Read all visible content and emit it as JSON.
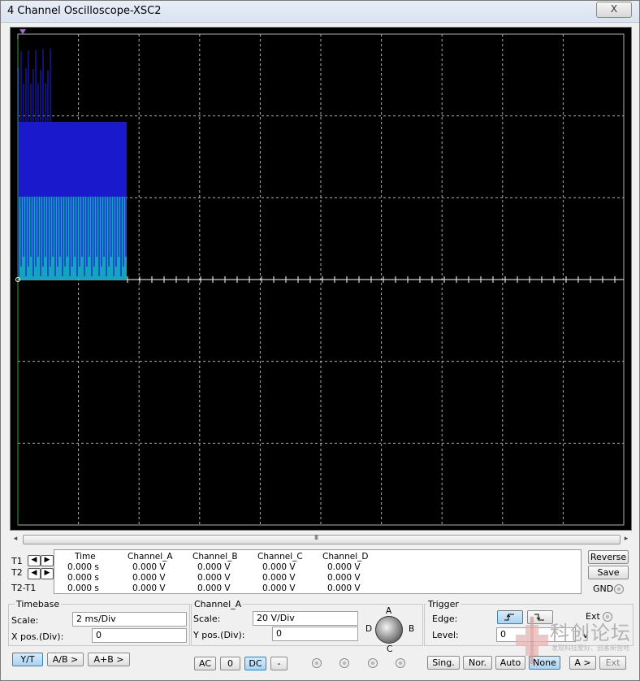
{
  "window": {
    "title": "4 Channel Oscilloscope-XSC2",
    "close_glyph": "X"
  },
  "scope": {
    "background": "#000000",
    "grid_color": "#b0b0b0",
    "channel_colors": {
      "A": "#1a1acc",
      "B": "#cc2020",
      "C": "#14a4c0",
      "D": "#30a030"
    }
  },
  "scrollbar": {
    "left_glyph": "◂",
    "right_glyph": "▸",
    "grip_glyph": "III"
  },
  "readout": {
    "headers": [
      "Time",
      "Channel_A",
      "Channel_B",
      "Channel_C",
      "Channel_D"
    ],
    "rows": [
      {
        "label": "T1",
        "time": "0.000 s",
        "a": "0.000 V",
        "b": "0.000 V",
        "c": "0.000 V",
        "d": "0.000 V"
      },
      {
        "label": "T2",
        "time": "0.000 s",
        "a": "0.000 V",
        "b": "0.000 V",
        "c": "0.000 V",
        "d": "0.000 V"
      },
      {
        "label": "T2-T1",
        "time": "0.000 s",
        "a": "0.000 V",
        "b": "0.000 V",
        "c": "0.000 V",
        "d": "0.000 V"
      }
    ],
    "arrow_left": "◀",
    "arrow_right": "▶"
  },
  "side_buttons": {
    "reverse": "Reverse",
    "save": "Save",
    "gnd": "GND"
  },
  "timebase": {
    "title": "Timebase",
    "scale_label": "Scale:",
    "scale_value": "2 ms/Div",
    "xpos_label": "X pos.(Div):",
    "xpos_value": "0",
    "buttons": [
      "Y/T",
      "A/B >",
      "A+B >"
    ]
  },
  "channel": {
    "title": "Channel_A",
    "scale_label": "Scale:",
    "scale_value": "20  V/Div",
    "ypos_label": "Y pos.(Div):",
    "ypos_value": "0",
    "buttons": [
      "AC",
      "0",
      "DC",
      "-"
    ],
    "knob_labels": {
      "a": "A",
      "b": "B",
      "c": "C",
      "d": "D"
    }
  },
  "trigger": {
    "title": "Trigger",
    "edge_label": "Edge:",
    "level_label": "Level:",
    "level_value": "0",
    "level_unit": "V",
    "ext_label": "Ext",
    "buttons": [
      "Sing.",
      "Nor.",
      "Auto",
      "None",
      "A >",
      "Ext"
    ]
  },
  "watermark": {
    "text": "科创论坛",
    "sub": "发现科技爱好、创客新营地"
  }
}
